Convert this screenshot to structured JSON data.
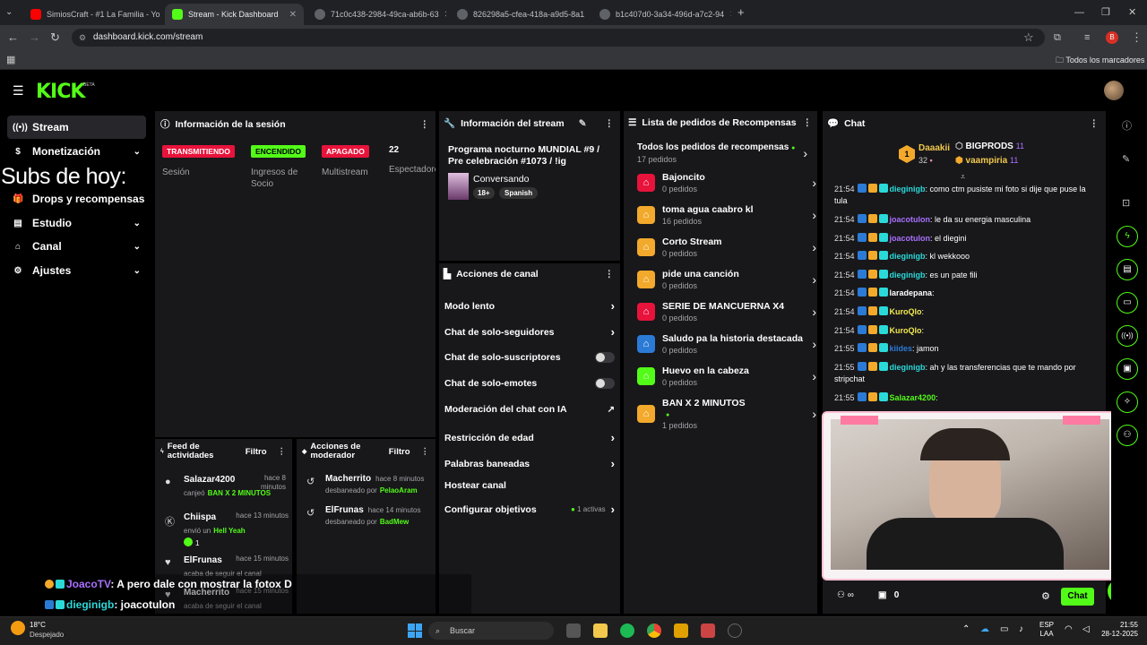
{
  "browser": {
    "tabs": [
      {
        "title": "SimiosCraft - #1 La Familia - Yo",
        "active": false
      },
      {
        "title": "Stream - Kick Dashboard",
        "active": true
      },
      {
        "title": "71c0c438-2984-49ca-ab6b-63",
        "active": false
      },
      {
        "title": "826298a5-cfea-418a-a9d5-8a1",
        "active": false
      },
      {
        "title": "b1c407d0-3a34-496d-a7c2-94",
        "active": false
      }
    ],
    "url": "dashboard.kick.com/stream",
    "bookmarks_label": "Todos los marcadores",
    "profile_initial": "B"
  },
  "kick": {
    "logo": "KICK",
    "beta": "BETA"
  },
  "sidebar": {
    "items": [
      {
        "label": "Stream",
        "icon": "stream-icon",
        "chevron": false
      },
      {
        "label": "Monetización",
        "icon": "dollar-icon",
        "chevron": true
      },
      {
        "label": "Drops y recompensas",
        "icon": "gift-icon",
        "chevron": false
      },
      {
        "label": "Estudio",
        "icon": "grid-icon",
        "chevron": true
      },
      {
        "label": "Canal",
        "icon": "channel-icon",
        "chevron": true
      },
      {
        "label": "Ajustes",
        "icon": "gear-icon",
        "chevron": true
      }
    ]
  },
  "overlay": {
    "subs_today": "Subs de hoy:",
    "chat_lines": [
      {
        "user": "JoacoTV",
        "text": ": A pero dale con mostrar la fotox D"
      },
      {
        "user": "dieginigb",
        "text": ": joacotulon"
      }
    ]
  },
  "session": {
    "title": "Información de la sesión",
    "stats": [
      {
        "badge": "TRANSMITIENDO",
        "label": "Sesión"
      },
      {
        "badge": "ENCENDIDO",
        "label": "Ingresos de Socio"
      },
      {
        "badge": "APAGADO",
        "label": "Multistream"
      },
      {
        "badge": "22",
        "label": "Espectadores"
      }
    ]
  },
  "stream_info": {
    "title": "Información del stream",
    "stream_title": "Programa nocturno MUNDIAL #9 / Pre celebración #1073 / !ig",
    "category": "Conversando",
    "tags": [
      "18+",
      "Spanish"
    ]
  },
  "channel_actions": {
    "title": "Acciones de canal",
    "items": [
      {
        "label": "Modo lento",
        "type": "arrow"
      },
      {
        "label": "Chat de solo-seguidores",
        "type": "arrow"
      },
      {
        "label": "Chat de solo-suscriptores",
        "type": "toggle"
      },
      {
        "label": "Chat de solo-emotes",
        "type": "toggle"
      },
      {
        "label": "Moderación del chat con IA",
        "type": "external"
      },
      {
        "label": "Restricción de edad",
        "type": "arrow"
      },
      {
        "label": "Palabras baneadas",
        "type": "arrow"
      },
      {
        "label": "Hostear canal",
        "type": "none"
      },
      {
        "label": "Configurar objetivos",
        "type": "arrow",
        "extra": "1 activas"
      }
    ]
  },
  "rewards": {
    "title": "Lista de pedidos de Recompensas",
    "all_label": "Todos los pedidos de recompensas",
    "all_count": "17 pedidos",
    "items": [
      {
        "name": "Bajoncito",
        "count": "0 pedidos",
        "color": "#e8133b",
        "icon": "ticket-icon"
      },
      {
        "name": "toma agua caabro kl",
        "count": "16 pedidos",
        "color": "#f2a92c",
        "icon": "ticket-icon"
      },
      {
        "name": "Corto Stream",
        "count": "0 pedidos",
        "color": "#f2a92c",
        "icon": "ticket-icon"
      },
      {
        "name": "pide una canción",
        "count": "0 pedidos",
        "color": "#f2a92c",
        "icon": "ticket-icon"
      },
      {
        "name": "SERIE DE MANCUERNA X4",
        "count": "0 pedidos",
        "color": "#e8133b",
        "icon": "ticket-icon"
      },
      {
        "name": "Saludo pa la historia destacada",
        "count": "0 pedidos",
        "color": "#2b7bd6",
        "icon": "ticket-icon"
      },
      {
        "name": "Huevo en la cabeza",
        "count": "0 pedidos",
        "color": "#53fc18",
        "icon": "ticket-icon"
      },
      {
        "name": "BAN X 2 MINUTOS",
        "count": "1 pedidos",
        "color": "#f2a92c",
        "icon": "ticket-icon"
      }
    ]
  },
  "chat": {
    "title": "Chat",
    "leaderboard": [
      {
        "rank": "1",
        "name": "Daaakii",
        "value": "32"
      },
      {
        "rank": "",
        "name": "BIGPRODS",
        "value": "11"
      },
      {
        "rank": "",
        "name": "vaampiria",
        "value": "11"
      }
    ],
    "messages": [
      {
        "time": "21:54",
        "user": "dieginigb",
        "color": "#2bd9d9",
        "text": ": como ctm pusiste mi foto si dije que puse la tula"
      },
      {
        "time": "21:54",
        "user": "joacotulon",
        "color": "#a970ff",
        "text": ": le da su energia masculina"
      },
      {
        "time": "21:54",
        "user": "joacotulon",
        "color": "#a970ff",
        "text": ": el diegini"
      },
      {
        "time": "21:54",
        "user": "dieginigb",
        "color": "#2bd9d9",
        "text": ": kl wekkooo"
      },
      {
        "time": "21:54",
        "user": "dieginigb",
        "color": "#2bd9d9",
        "text": ": es un pate fili"
      },
      {
        "time": "21:54",
        "user": "laradepana",
        "color": "#ffffff",
        "text": ":"
      },
      {
        "time": "21:54",
        "user": "KuroQlo",
        "color": "#f2e94e",
        "text": ":"
      },
      {
        "time": "21:54",
        "user": "KuroQlo",
        "color": "#f2e94e",
        "text": ":"
      },
      {
        "time": "21:55",
        "user": "kiides",
        "color": "#2b7bd6",
        "text": ": jamon"
      },
      {
        "time": "21:55",
        "user": "dieginigb",
        "color": "#2bd9d9",
        "text": ": ah y las transferencias que te mando por stripchat"
      },
      {
        "time": "21:55",
        "user": "Salazar4200",
        "color": "#53fc18",
        "text": ":"
      }
    ],
    "viewers": "0",
    "send_label": "Chat"
  },
  "activity": {
    "title": "Feed de actividades",
    "filter": "Filtro",
    "items": [
      {
        "user": "Salazar4200",
        "time": "hace 8 minutos",
        "action": "canjeó",
        "target": "BAN X 2 MINUTOS",
        "extra": ""
      },
      {
        "user": "Chiispa",
        "time": "hace 13 minutos",
        "action": "envió un",
        "target": "Hell Yeah",
        "extra": "1"
      },
      {
        "user": "ElFrunas",
        "time": "hace 15 minutos",
        "action": "acaba de seguir el canal",
        "target": "",
        "extra": ""
      },
      {
        "user": "Macherrito",
        "time": "hace 15 minutos",
        "action": "acaba de seguir el canal",
        "target": "",
        "extra": ""
      }
    ]
  },
  "mod_actions": {
    "title": "Acciones de moderador",
    "filter": "Filtro",
    "items": [
      {
        "user": "Macherrito",
        "time": "hace 8 minutos",
        "action": "desbaneado por",
        "by": "PelaoAram"
      },
      {
        "user": "ElFrunas",
        "time": "hace 14 minutos",
        "action": "desbaneado por",
        "by": "BadMew"
      }
    ]
  },
  "taskbar": {
    "weather_temp": "18°C",
    "weather_desc": "Despejado",
    "search": "Buscar",
    "lang": "ESP",
    "lang2": "LAA",
    "time": "21:55",
    "date": "28-12-2025"
  }
}
